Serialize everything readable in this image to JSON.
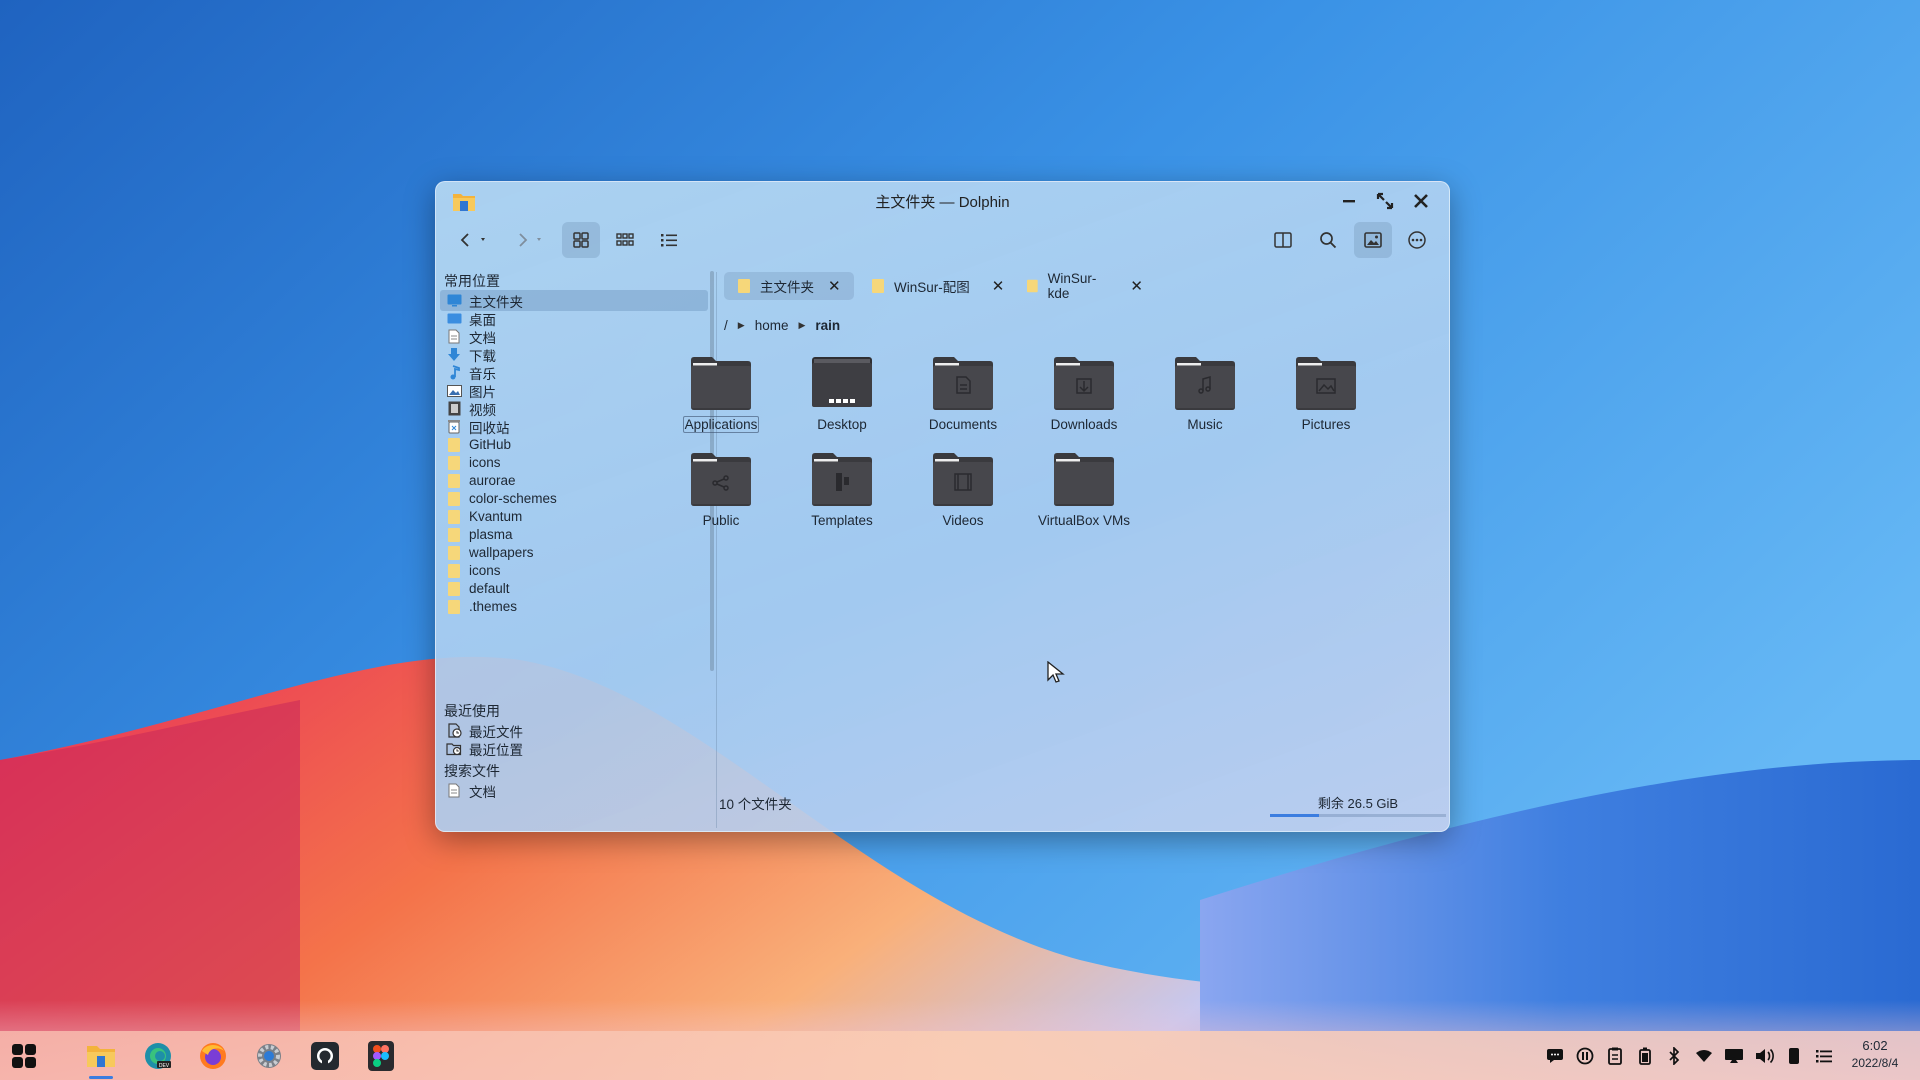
{
  "window": {
    "title": "主文件夹 — Dolphin"
  },
  "sidebar": {
    "places_heading": "常用位置",
    "places": [
      {
        "label": "主文件夹",
        "icon": "home-icon"
      },
      {
        "label": "桌面",
        "icon": "desktop-icon"
      },
      {
        "label": "文档",
        "icon": "document-icon"
      },
      {
        "label": "下载",
        "icon": "download-icon"
      },
      {
        "label": "音乐",
        "icon": "music-icon"
      },
      {
        "label": "图片",
        "icon": "picture-icon"
      },
      {
        "label": "视频",
        "icon": "video-icon"
      },
      {
        "label": "回收站",
        "icon": "trash-icon"
      },
      {
        "label": "GitHub",
        "icon": "folder-icon"
      },
      {
        "label": "icons",
        "icon": "folder-icon"
      },
      {
        "label": "aurorae",
        "icon": "folder-icon"
      },
      {
        "label": "color-schemes",
        "icon": "folder-icon"
      },
      {
        "label": "Kvantum",
        "icon": "folder-icon"
      },
      {
        "label": "plasma",
        "icon": "folder-icon"
      },
      {
        "label": "wallpapers",
        "icon": "folder-icon"
      },
      {
        "label": "icons",
        "icon": "folder-icon"
      },
      {
        "label": "default",
        "icon": "folder-icon"
      },
      {
        "label": ".themes",
        "icon": "folder-icon"
      }
    ],
    "recent_heading": "最近使用",
    "recent": [
      {
        "label": "最近文件",
        "icon": "recent-files-icon"
      },
      {
        "label": "最近位置",
        "icon": "recent-locations-icon"
      }
    ],
    "search_heading": "搜索文件",
    "search": [
      {
        "label": "文档",
        "icon": "document-icon"
      }
    ]
  },
  "tabs": [
    {
      "label": "主文件夹",
      "close": "✕"
    },
    {
      "label": "WinSur-配图",
      "close": "✕"
    },
    {
      "label": "WinSur-kde",
      "close": "✕"
    }
  ],
  "breadcrumb": {
    "root": "/",
    "parts": [
      "home",
      "rain"
    ]
  },
  "files": [
    {
      "name": "Applications",
      "emblem": "none"
    },
    {
      "name": "Desktop",
      "emblem": "desktop"
    },
    {
      "name": "Documents",
      "emblem": "document"
    },
    {
      "name": "Downloads",
      "emblem": "download"
    },
    {
      "name": "Music",
      "emblem": "music"
    },
    {
      "name": "Pictures",
      "emblem": "picture"
    },
    {
      "name": "Public",
      "emblem": "share"
    },
    {
      "name": "Templates",
      "emblem": "template"
    },
    {
      "name": "Videos",
      "emblem": "video"
    },
    {
      "name": "VirtualBox VMs",
      "emblem": "none"
    }
  ],
  "status": {
    "count": "10 个文件夹",
    "free_space": "剩余 26.5 GiB",
    "used_fraction": 0.28
  },
  "taskbar": {
    "apps": [
      "start-menu-icon",
      "file-manager-icon",
      "edge-dev-icon",
      "firefox-icon",
      "settings-icon",
      "github-icon",
      "figma-icon"
    ],
    "tray": [
      "chat-icon",
      "pause-icon",
      "clipboard-icon",
      "battery-icon",
      "bluetooth-icon",
      "wifi-icon",
      "screen-icon",
      "volume-icon",
      "phone-icon",
      "list-icon"
    ],
    "time": "6:02",
    "date": "2022/8/4"
  },
  "colors": {
    "accent": "#3b7de0",
    "folder_dark": "#47474c",
    "folder_yellow": "#f6d77a"
  }
}
